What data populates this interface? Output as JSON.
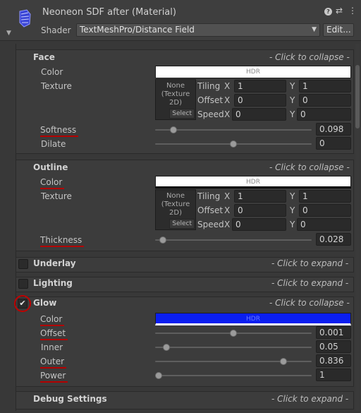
{
  "header": {
    "title": "Neoneon SDF after (Material)",
    "shader_label": "Shader",
    "shader_value": "TextMeshPro/Distance Field",
    "edit_label": "Edit..."
  },
  "face": {
    "title": "Face",
    "hint": "- Click to collapse -",
    "color_label": "Color",
    "color_hdr": "HDR",
    "color_value": "#ffffff",
    "texture_label": "Texture",
    "texture_none": "None (Texture 2D)",
    "texture_select": "Select",
    "tiling_label": "Tiling",
    "offset_label": "Offset",
    "speed_label": "Speed",
    "x_label": "X",
    "y_label": "Y",
    "tiling_x": "1",
    "tiling_y": "1",
    "offset_x": "0",
    "offset_y": "0",
    "speed_x": "0",
    "speed_y": "0",
    "softness_label": "Softness",
    "softness_value": "0.098",
    "softness_fraction": 0.098,
    "dilate_label": "Dilate",
    "dilate_value": "0",
    "dilate_fraction": 0.5
  },
  "outline": {
    "title": "Outline",
    "hint": "- Click to collapse -",
    "color_label": "Color",
    "color_hdr": "HDR",
    "color_value": "#ffffff",
    "texture_label": "Texture",
    "texture_none": "None (Texture 2D)",
    "texture_select": "Select",
    "tiling_label": "Tiling",
    "offset_label": "Offset",
    "speed_label": "Speed",
    "x_label": "X",
    "y_label": "Y",
    "tiling_x": "1",
    "tiling_y": "1",
    "offset_x": "0",
    "offset_y": "0",
    "speed_x": "0",
    "speed_y": "0",
    "thickness_label": "Thickness",
    "thickness_value": "0.028",
    "thickness_fraction": 0.028
  },
  "underlay": {
    "title": "Underlay",
    "hint": "- Click to expand -"
  },
  "lighting": {
    "title": "Lighting",
    "hint": "- Click to expand -"
  },
  "glow": {
    "title": "Glow",
    "hint": "- Click to collapse -",
    "enabled": true,
    "color_label": "Color",
    "color_hdr": "HDR",
    "color_value": "#0a1ef0",
    "offset_label": "Offset",
    "offset_value": "0.001",
    "offset_fraction": 0.5,
    "inner_label": "Inner",
    "inner_value": "0.05",
    "inner_fraction": 0.05,
    "outer_label": "Outer",
    "outer_value": "0.836",
    "outer_fraction": 0.836,
    "power_label": "Power",
    "power_value": "1",
    "power_fraction": 0.0
  },
  "debug": {
    "title": "Debug Settings",
    "hint": "- Click to expand -"
  },
  "colors": {
    "accent_red": "#b30000",
    "glow_blue": "#0a1ef0"
  }
}
